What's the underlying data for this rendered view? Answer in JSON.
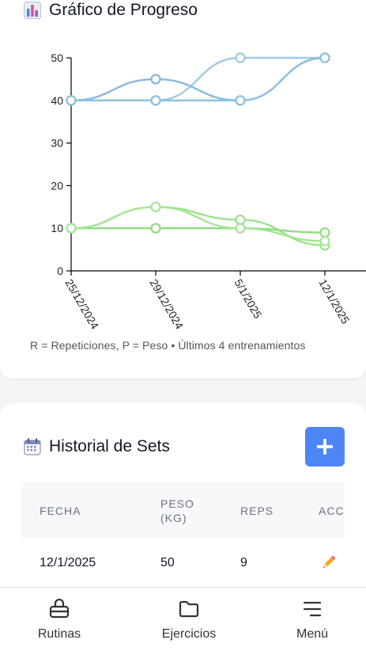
{
  "progress_card": {
    "title": "Gráfico de Progreso",
    "title_icon": "bar-chart-icon",
    "footnote": "R = Repeticiones, P = Peso • Últimos 4 entrenamientos"
  },
  "chart_data": {
    "type": "line",
    "categories": [
      "25/12/2024",
      "29/12/2024",
      "5/1/2025",
      "12/1/2025"
    ],
    "ylim": [
      0,
      55
    ],
    "yticks": [
      0,
      10,
      20,
      30,
      40,
      50
    ],
    "grid": false,
    "series": [
      {
        "values": [
          40,
          40,
          50,
          50
        ],
        "color": "#9ecae1",
        "group": "peso"
      },
      {
        "values": [
          40,
          45,
          40,
          50
        ],
        "color": "#86b8dc",
        "group": "peso"
      },
      {
        "values": [
          40,
          40,
          40,
          50
        ],
        "color": "#8cc0e0",
        "group": "peso"
      },
      {
        "values": [
          10,
          15,
          12,
          6
        ],
        "color": "#9be389",
        "group": "reps"
      },
      {
        "values": [
          10,
          10,
          10,
          9
        ],
        "color": "#8fdc80",
        "group": "reps"
      },
      {
        "values": [
          10,
          15,
          10,
          7
        ],
        "color": "#a6e596",
        "group": "reps"
      }
    ]
  },
  "history_card": {
    "title": "Historial de Sets",
    "title_icon": "calendar-icon",
    "add_icon": "plus-icon",
    "columns": [
      "FECHA",
      "PESO\n(KG)",
      "REPS",
      "ACCIONES"
    ],
    "rows": [
      {
        "fecha": "12/1/2025",
        "peso": "50",
        "reps": "9",
        "action_icon": "pencil-icon"
      }
    ]
  },
  "nav": {
    "items": [
      {
        "label": "Rutinas",
        "icon": "workout-bag-icon"
      },
      {
        "label": "Ejercicios",
        "icon": "folder-icon"
      },
      {
        "label": "Menú",
        "icon": "menu-icon"
      }
    ]
  }
}
